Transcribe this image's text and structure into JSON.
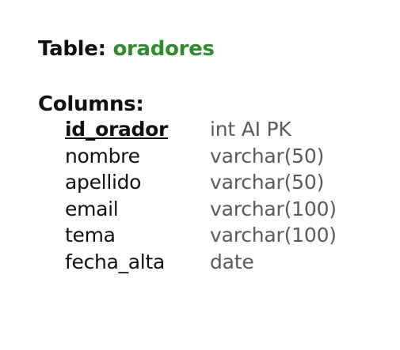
{
  "table": {
    "label": "Table:",
    "name": "oradores"
  },
  "columns_heading": "Columns:",
  "columns": [
    {
      "name": "id_orador",
      "type": "int AI PK",
      "primary_key": true
    },
    {
      "name": "nombre",
      "type": "varchar(50)"
    },
    {
      "name": "apellido",
      "type": "varchar(50)"
    },
    {
      "name": "email",
      "type": "varchar(100)"
    },
    {
      "name": "tema",
      "type": "varchar(100)"
    },
    {
      "name": "fecha_alta",
      "type": "date"
    }
  ],
  "colors": {
    "table_name": "#2e8b2e",
    "text": "#111111",
    "type_text": "#5a5a5a",
    "background": "#ffffff"
  }
}
